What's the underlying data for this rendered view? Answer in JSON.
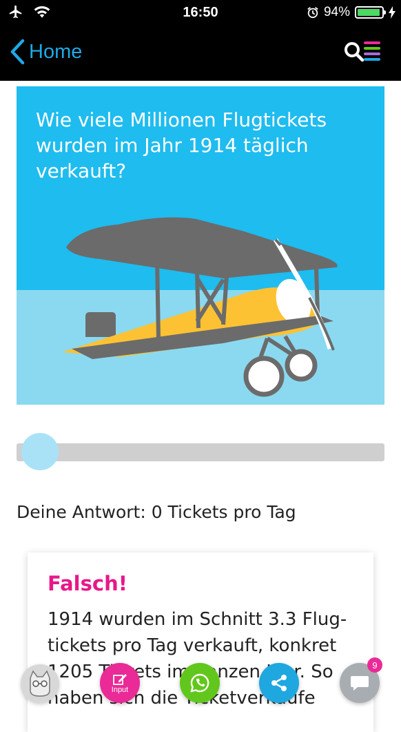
{
  "status_bar": {
    "time": "16:50",
    "battery_percent_label": "94%",
    "battery_level": 0.94,
    "battery_color": "#4cd964"
  },
  "nav": {
    "back_label": "Home",
    "back_icon": "chevron-left-icon",
    "menu_icon": "search-menu-icon",
    "accent": "#1fa9e6"
  },
  "hero": {
    "question": "Wie viele Millionen Flugtickets wurden im Jahr 1914 täglich verkauft?",
    "illustration": "biplane"
  },
  "slider": {
    "value": 0
  },
  "answer": {
    "text": "Deine Antwort: 0 Tickets pro Tag"
  },
  "result": {
    "title": "Falsch!",
    "text": "1914 wurden im Schnitt 3.3 Flug-tickets pro Tag verkauft, konkret 1205 Tickets im ganzen Jahr. So haben sich die Ticketverkäufe"
  },
  "fabs": {
    "input_label": "Input",
    "chat_badge": "9"
  },
  "colors": {
    "pink": "#ea2a96",
    "green": "#62c71c",
    "blue": "#1fa7e0",
    "sky": "#1ebcef",
    "plane_gray": "#6b6b6b",
    "plane_yellow": "#fcc234"
  }
}
